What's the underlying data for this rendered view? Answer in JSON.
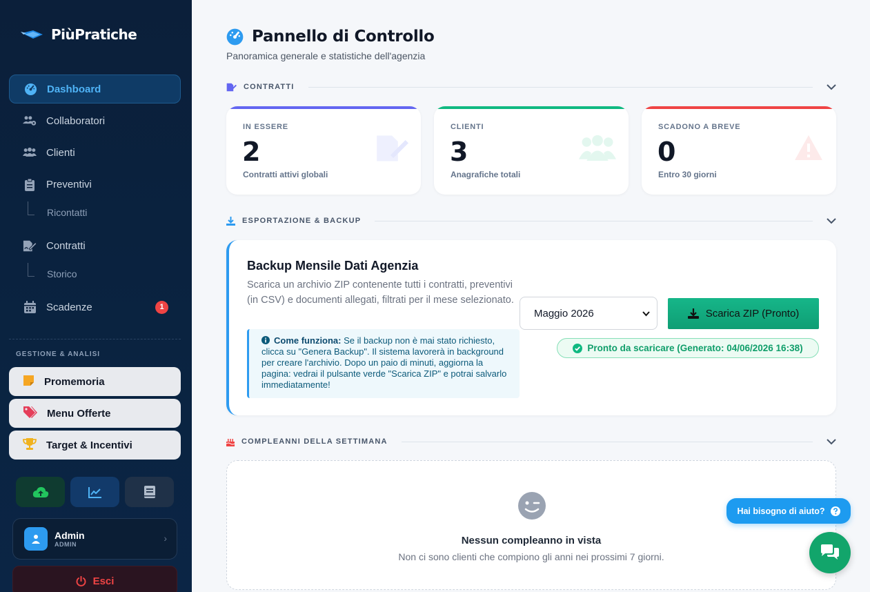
{
  "brand": {
    "name": "PiùPratiche"
  },
  "sidebar": {
    "nav": [
      {
        "label": "Dashboard",
        "icon": "gauge-icon",
        "active": true
      },
      {
        "label": "Collaboratori",
        "icon": "users-gear-icon"
      },
      {
        "label": "Clienti",
        "icon": "users-icon"
      },
      {
        "label": "Preventivi",
        "icon": "clipboard-icon"
      },
      {
        "label": "Contratti",
        "icon": "file-signature-icon"
      },
      {
        "label": "Scadenze",
        "icon": "calendar-icon",
        "badge": "1"
      }
    ],
    "sub": {
      "ricontatti": "Ricontatti",
      "storico": "Storico"
    },
    "section_label": "GESTIONE & ANALISI",
    "tools": [
      {
        "label": "Promemoria",
        "icon": "sticky-note-icon"
      },
      {
        "label": "Menu Offerte",
        "icon": "tags-icon"
      },
      {
        "label": "Target & Incentivi",
        "icon": "trophy-icon"
      }
    ],
    "user": {
      "name": "Admin",
      "role": "ADMIN"
    },
    "logout": "Esci"
  },
  "header": {
    "title": "Pannello di Controllo",
    "subtitle": "Panoramica generale e statistiche dell'agenzia"
  },
  "sections": {
    "contratti": "CONTRATTI",
    "export": "ESPORTAZIONE & BACKUP",
    "birthdays": "COMPLEANNI DELLA SETTIMANA"
  },
  "stats": [
    {
      "label": "IN ESSERE",
      "value": "2",
      "desc": "Contratti attivi globali",
      "color": "#6366f1"
    },
    {
      "label": "CLIENTI",
      "value": "3",
      "desc": "Anagrafiche totali",
      "color": "#10b981"
    },
    {
      "label": "SCADONO A BREVE",
      "value": "0",
      "desc": "Entro 30 giorni",
      "color": "#ef4444"
    }
  ],
  "backup": {
    "title": "Backup Mensile Dati Agenzia",
    "desc": "Scarica un archivio ZIP contenente tutti i contratti, preventivi (in CSV) e documenti allegati, filtrati per il mese selezionato.",
    "info_title": "Come funziona:",
    "info_text": " Se il backup non è mai stato richiesto, clicca su \"Genera Backup\". Il sistema lavorerà in background per creare l'archivio. Dopo un paio di minuti, aggiorna la pagina: vedrai il pulsante verde \"Scarica ZIP\" e potrai salvarlo immediatamente!",
    "month": "Maggio 2026",
    "download_label": "Scarica ZIP (Pronto)",
    "ready_text": "Pronto da scaricare (Generato: 04/06/2026 16:38)"
  },
  "birthdays": {
    "empty_title": "Nessun compleanno in vista",
    "empty_desc": "Non ci sono clienti che compiono gli anni nei prossimi 7 giorni."
  },
  "help": {
    "bubble": "Hai bisogno di aiuto?"
  }
}
